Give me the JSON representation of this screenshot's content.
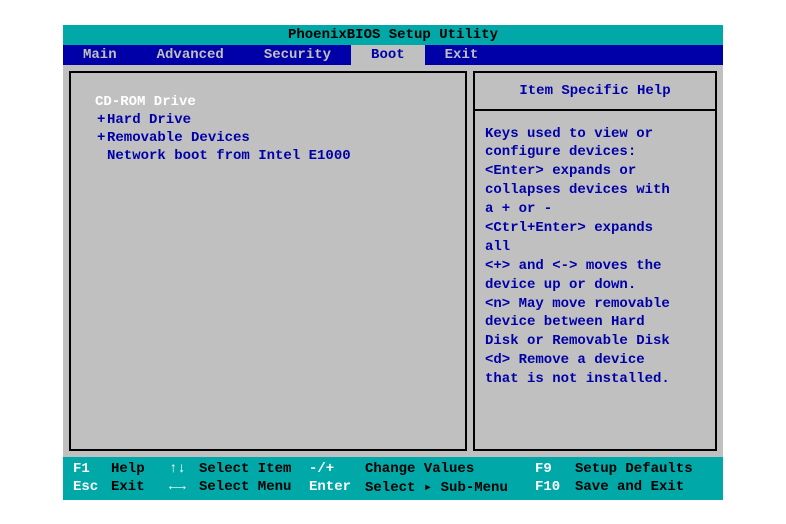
{
  "title": "PhoenixBIOS Setup Utility",
  "menu": {
    "items": [
      "Main",
      "Advanced",
      "Security",
      "Boot",
      "Exit"
    ],
    "selected_index": 3
  },
  "boot": {
    "items": [
      {
        "prefix": "",
        "label": "CD-ROM Drive",
        "selected": true
      },
      {
        "prefix": "+",
        "label": "Hard Drive",
        "selected": false
      },
      {
        "prefix": "+",
        "label": "Removable Devices",
        "selected": false
      },
      {
        "prefix": "",
        "label": "Network boot from Intel E1000",
        "selected": false
      }
    ]
  },
  "help": {
    "title": "Item Specific Help",
    "lines": [
      "Keys used to view or",
      "configure devices:",
      "<Enter> expands or",
      "collapses devices with",
      "a + or -",
      "<Ctrl+Enter> expands",
      "all",
      "<+> and <-> moves the",
      "device up or down.",
      "<n> May move removable",
      "device between Hard",
      "Disk or Removable Disk",
      "<d> Remove a device",
      "that is not installed."
    ]
  },
  "footer": {
    "r1": {
      "k1": "F1",
      "a1": "Help",
      "s1": "↑↓",
      "a2": "Select Item",
      "k2": "-/+",
      "a3": "Change Values",
      "k3": "F9",
      "a4": "Setup Defaults"
    },
    "r2": {
      "k1": "Esc",
      "a1": "Exit",
      "s1": "←→",
      "a2": "Select Menu",
      "k2": "Enter",
      "a3": "Select ▸ Sub-Menu",
      "k3": "F10",
      "a4": "Save and Exit"
    }
  }
}
